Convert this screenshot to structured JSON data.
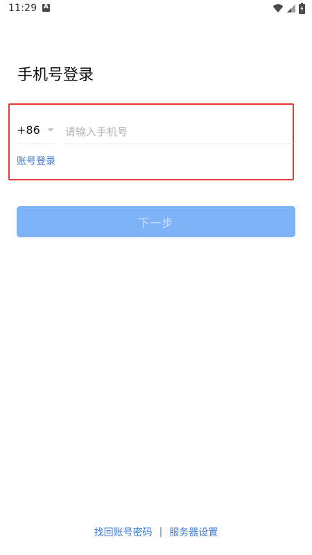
{
  "status_bar": {
    "time": "11:29",
    "icons": [
      "a-notification-icon",
      "wifi-icon",
      "signal-icon",
      "battery-icon"
    ]
  },
  "title": "手机号登录",
  "phone": {
    "country_code": "+86",
    "placeholder": "请输入手机号",
    "value": ""
  },
  "account_login_label": "账号登录",
  "next_button_label": "下一步",
  "footer": {
    "recover_password_label": "找回账号密码",
    "divider": "|",
    "server_settings_label": "服务器设置"
  },
  "colors": {
    "accent": "#3d7ad8",
    "button_disabled_bg": "#7fb3f7",
    "highlight_border": "#e53935"
  }
}
